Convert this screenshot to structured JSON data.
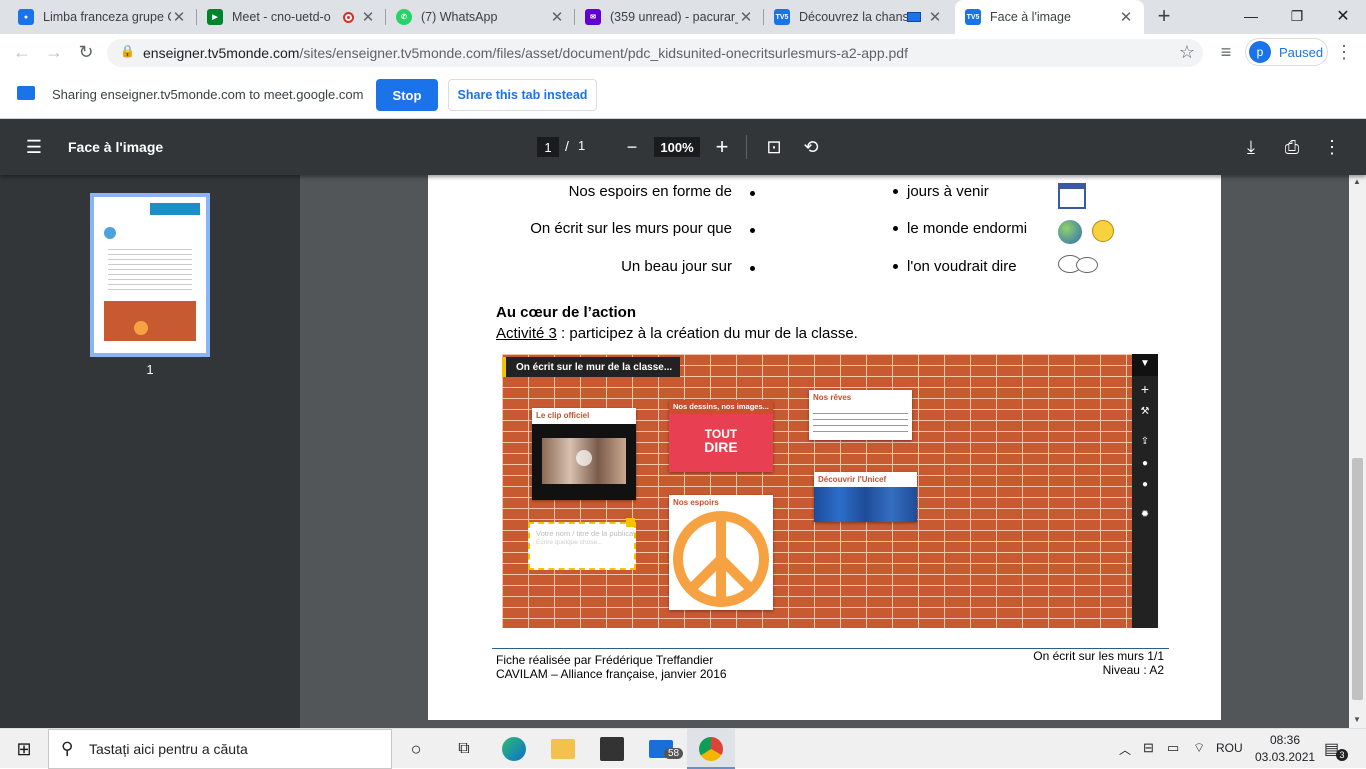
{
  "tabs": [
    {
      "title": "Limba franceza grupe C",
      "favicon": "person-icon",
      "color": "#1a73e8"
    },
    {
      "title": "Meet - cno-uetd-o",
      "favicon": "meet-icon",
      "color": "#00832d"
    },
    {
      "title": "(7) WhatsApp",
      "favicon": "whatsapp-icon",
      "color": "#25d366"
    },
    {
      "title": "(359 unread) - pacurar_",
      "favicon": "mail-icon",
      "color": "#6001d2"
    },
    {
      "title": "Découvrez la chans",
      "favicon": "tv5-icon",
      "color": "#1a73e8"
    },
    {
      "title": "Face à l'image",
      "favicon": "tv5-icon",
      "color": "#1a73e8"
    }
  ],
  "tv5_label": "TV5",
  "address": {
    "domain": "enseigner.tv5monde.com",
    "path": "/sites/enseigner.tv5monde.com/files/asset/document/pdc_kidsunited-onecritsurlesmurs-a2-app.pdf"
  },
  "profile": {
    "initial": "p",
    "status": "Paused"
  },
  "sharing": {
    "text": "Sharing enseigner.tv5monde.com to meet.google.com",
    "stop": "Stop",
    "share_tab": "Share this tab instead"
  },
  "pdf": {
    "title": "Face à l'image",
    "page_current": "1",
    "page_sep": "/",
    "page_total": "1",
    "zoom": "100%",
    "thumb_page": "1"
  },
  "doc": {
    "matches": [
      {
        "left": "Nos espoirs en forme de",
        "right": "jours à venir"
      },
      {
        "left": "On écrit sur les murs pour que",
        "right": "le monde endormi"
      },
      {
        "left": "Un beau jour sur",
        "right": "l'on voudrait dire"
      }
    ],
    "section_title": "Au cœur de l’action",
    "activity_link": "Activité 3",
    "activity_text": " : participez à la création du mur de la classe.",
    "wall": {
      "banner": "On écrit sur le mur de la classe...",
      "card_clip": "Le clip officiel",
      "card_drawings": "Nos dessins, nos images...",
      "drawings_text_1": "TOUT",
      "drawings_text_2": "DIRE",
      "card_dreams": "Nos rêves",
      "card_unicef": "Découvrir l'Unicef",
      "card_hopes": "Nos espoirs",
      "new_post_title": "Votre nom / titre de la publicati",
      "new_post_body": "Écrire quelque chose..."
    },
    "footer_left_1": "Fiche réalisée par Frédérique Treffandier",
    "footer_left_2": "CAVILAM – Alliance française, janvier 2016",
    "footer_right_1": "On écrit sur les murs 1/1",
    "footer_right_2": "Niveau : A2"
  },
  "taskbar": {
    "search_placeholder": "Tastați aici pentru a căuta",
    "mail_badge": "58",
    "lang": "ROU",
    "time": "08:36",
    "date": "03.03.2021",
    "notif_count": "3"
  }
}
